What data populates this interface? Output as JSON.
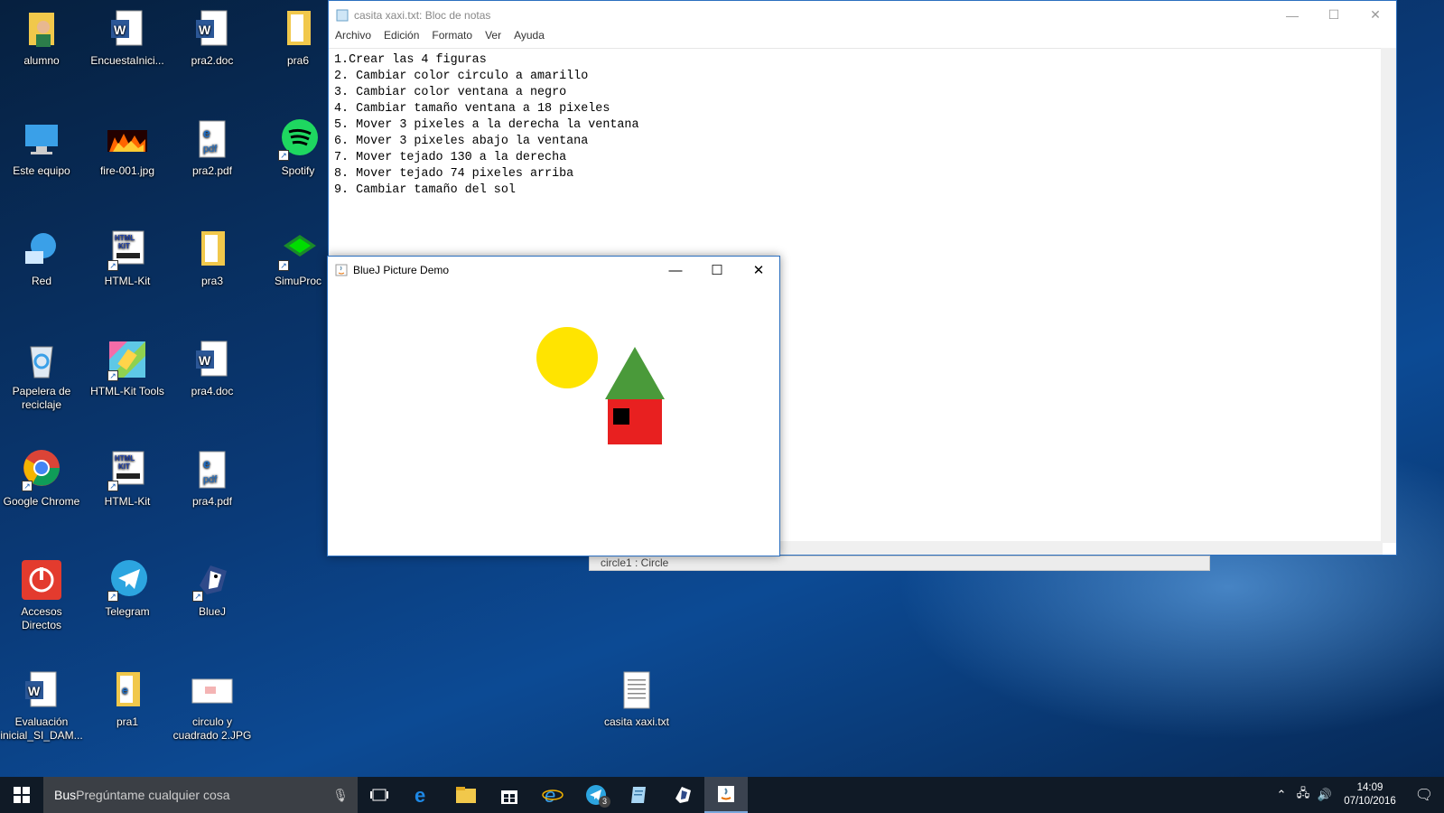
{
  "desktop": {
    "icons": [
      {
        "label": "alumno",
        "icon": "user-folder-icon"
      },
      {
        "label": "EncuestaInici...",
        "icon": "word-doc-icon"
      },
      {
        "label": "pra2.doc",
        "icon": "word-doc-icon"
      },
      {
        "label": "pra6",
        "icon": "folder-icon"
      },
      {
        "label": "Este equipo",
        "icon": "computer-icon"
      },
      {
        "label": "fire-001.jpg",
        "icon": "image-icon"
      },
      {
        "label": "pra2.pdf",
        "icon": "pdf-icon"
      },
      {
        "label": "Spotify",
        "icon": "spotify-icon"
      },
      {
        "label": "Red",
        "icon": "network-icon"
      },
      {
        "label": "HTML-Kit",
        "icon": "htmlkit-icon"
      },
      {
        "label": "pra3",
        "icon": "folder-icon"
      },
      {
        "label": "SimuProc",
        "icon": "chip-icon"
      },
      {
        "label": "Papelera de reciclaje",
        "icon": "recycle-bin-icon"
      },
      {
        "label": "HTML-Kit Tools",
        "icon": "htmlkit-tools-icon"
      },
      {
        "label": "pra4.doc",
        "icon": "word-doc-icon"
      },
      {
        "label": "Google Chrome",
        "icon": "chrome-icon"
      },
      {
        "label": "HTML-Kit",
        "icon": "htmlkit-icon"
      },
      {
        "label": "pra4.pdf",
        "icon": "pdf-icon"
      },
      {
        "label": "Accesos Directos",
        "icon": "power-icon"
      },
      {
        "label": "Telegram",
        "icon": "telegram-icon"
      },
      {
        "label": "BlueJ",
        "icon": "bluej-icon"
      },
      {
        "label": "Evaluación inicial_SI_DAM...",
        "icon": "word-doc-icon"
      },
      {
        "label": "pra1",
        "icon": "folder-icon"
      },
      {
        "label": "circulo y cuadrado 2.JPG",
        "icon": "image-icon"
      },
      {
        "label": "casita xaxi.txt",
        "icon": "text-file-icon"
      }
    ]
  },
  "notepad": {
    "title": "casita xaxi.txt: Bloc de notas",
    "menu": [
      "Archivo",
      "Edición",
      "Formato",
      "Ver",
      "Ayuda"
    ],
    "lines": [
      "1.Crear las 4 figuras",
      "2. Cambiar color circulo a amarillo",
      "3. Cambiar color ventana a negro",
      "4. Cambiar tamaño ventana a 18 pixeles",
      "5. Mover 3 pixeles a la derecha la ventana",
      "6. Mover 3 pixeles abajo la ventana",
      "7. Mover tejado 130 a la derecha",
      "8. Mover tejado 74 pixeles arriba",
      "9. Cambiar tamaño del sol"
    ]
  },
  "behind_window": {
    "label": "circle1 : Circle"
  },
  "bluej": {
    "title": "BlueJ Picture Demo",
    "colors": {
      "sun": "#ffe400",
      "roof": "#4a9a3a",
      "wall": "#e82020",
      "window": "#000000"
    }
  },
  "taskbar": {
    "search_prefix": "Bus",
    "search_placeholder": "Pregúntame cualquier cosa",
    "apps": [
      "task-view-icon",
      "edge-icon",
      "file-explorer-icon",
      "store-icon",
      "internet-explorer-icon",
      "telegram-icon",
      "notepad-icon",
      "bluej-icon",
      "java-icon"
    ],
    "telegram_badge": "3",
    "time": "14:09",
    "date": "07/10/2016"
  }
}
